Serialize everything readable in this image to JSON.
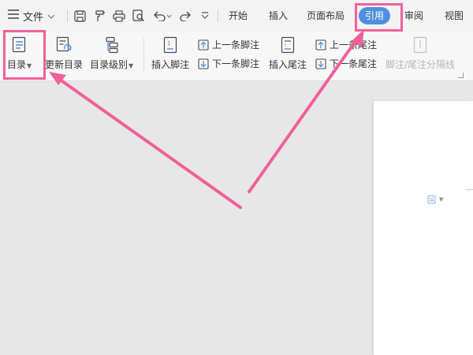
{
  "menubar": {
    "file_label": "文件",
    "tabs": [
      "开始",
      "插入",
      "页面布局"
    ],
    "active_tab": "引用",
    "tabs_after": [
      "审阅",
      "视图"
    ]
  },
  "ribbon": {
    "toc": "目录",
    "update_toc": "更新目录",
    "toc_level": "目录级别",
    "insert_footnote": "插入脚注",
    "prev_footnote": "上一条脚注",
    "next_footnote": "下一条脚注",
    "insert_endnote": "插入尾注",
    "prev_endnote": "上一条尾注",
    "next_endnote": "下一条尾注",
    "footnote_separator": "脚注/尾注分隔线"
  },
  "icons": {
    "menu": "hamburger-icon",
    "save": "save-icon",
    "format_painter": "format-painter-icon",
    "print": "print-icon",
    "print_preview": "print-preview-icon",
    "undo": "undo-icon",
    "redo": "redo-icon",
    "more": "more-icon",
    "paste_options": "paste-options-icon"
  },
  "colors": {
    "accent": "#4f8fe0",
    "annotation": "#f0609a"
  }
}
